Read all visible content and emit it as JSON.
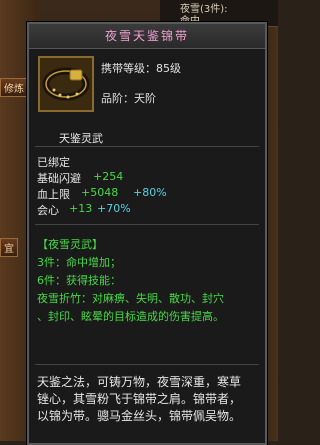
{
  "bg": {
    "top_line1": "夜雪(3件):",
    "top_line2": "命中",
    "side_left_1": "修炼",
    "side_left_2": "宜",
    "side_right_1": "",
    "side_right_2": ""
  },
  "tooltip": {
    "title": "夜雪天鉴锦带",
    "req_level": "携带等级：85级",
    "grade": "品阶：天阶",
    "subtitle": "天鉴灵武",
    "bound": "已绑定",
    "stats": [
      {
        "name": "基础闪避",
        "value": "+254"
      },
      {
        "name": "血上限",
        "value": "+5048",
        "extra": "+80%"
      },
      {
        "name": "会心",
        "value": "+13",
        "extra": "+70%"
      }
    ],
    "set_title": "【夜雪灵武】",
    "set_3": "3件：命中增加；",
    "set_6": "6件：获得技能：",
    "skill_text_1": "夜雪折竹：对麻痹、失明、散功、封穴",
    "skill_text_2": "、封印、眩晕的目标造成的伤害提高。",
    "desc_1": "天鉴之法，可铸万物，夜雪深重，寒草",
    "desc_2": "锉心，其雪粉飞于锦带之肩。锦带者，",
    "desc_3": "以锦为带。骢马金丝头，锦带佩吴物。"
  },
  "colors": {
    "title_pink": "#f0a0d0",
    "set_green": "#48d848",
    "bonus_cyan": "#5ad0e0",
    "skill_yellow": "#e8e000"
  },
  "icons": {
    "item": "belt-icon"
  }
}
